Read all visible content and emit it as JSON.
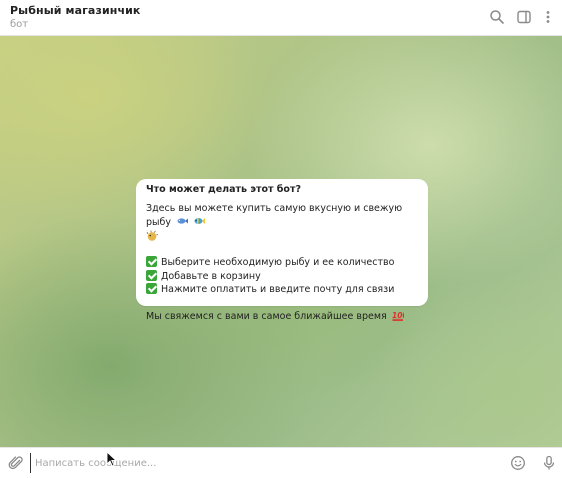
{
  "header": {
    "title": "Рыбный магазинчик",
    "subtitle": "бот",
    "icons": [
      "search-icon",
      "sidebar-toggle-icon",
      "more-vertical-icon"
    ]
  },
  "message": {
    "title": "Что может делать этот бот?",
    "intro": "Здесь вы можете купить самую вкусную и свежую рыбу",
    "intro_emojis": [
      "fish-emoji",
      "tropical-fish-emoji",
      "blowfish-emoji"
    ],
    "steps": [
      "Выберите необходимую рыбу и ее количество",
      "Добавьте в корзину",
      "Нажмите оплатить и введите почту для связи"
    ],
    "step_icon": "check-mark-button-emoji",
    "footer": "Мы свяжемся с вами в самое ближайшее время",
    "footer_emoji": "hundred-points-emoji"
  },
  "composer": {
    "placeholder": "Написать сообщение...",
    "value": "",
    "icons": [
      "paperclip-icon",
      "smile-icon",
      "microphone-icon"
    ]
  },
  "colors": {
    "accent_check": "#3aa63a",
    "header_title": "#222222",
    "header_subtitle": "#9a9a9a",
    "icon_gray": "#8a8a8a"
  }
}
